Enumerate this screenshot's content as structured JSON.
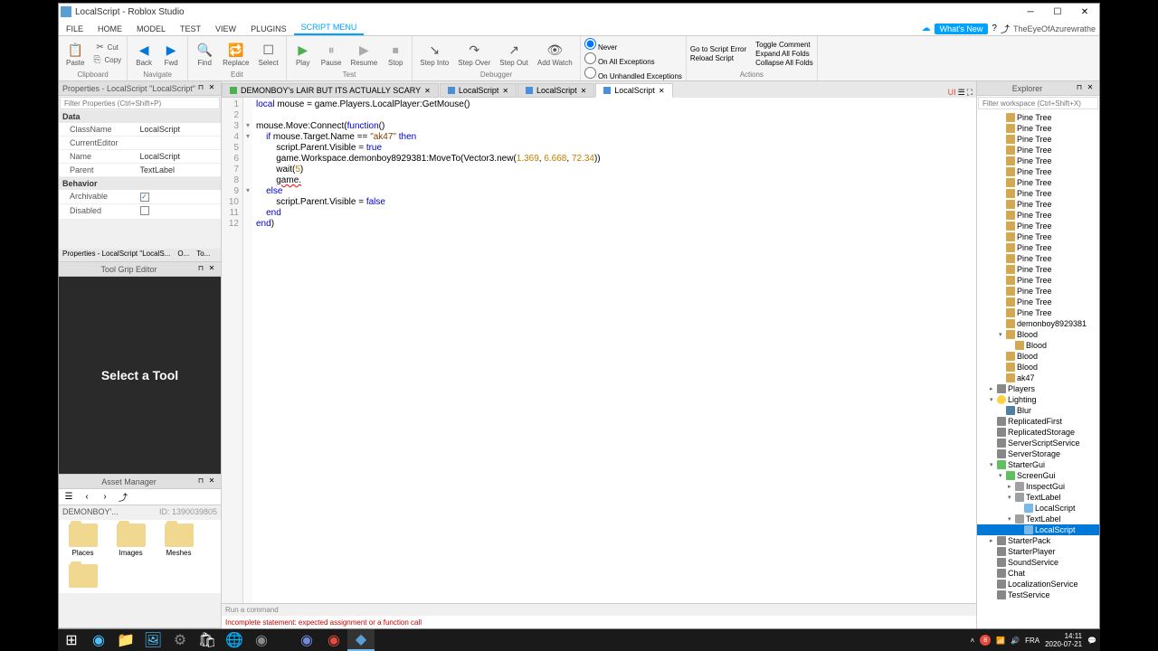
{
  "window": {
    "title": "LocalScript - Roblox Studio"
  },
  "menu": {
    "tabs": [
      "FILE",
      "HOME",
      "MODEL",
      "TEST",
      "VIEW",
      "PLUGINS",
      "SCRIPT MENU"
    ],
    "active": 6,
    "whats_new": "What's New",
    "username": "TheEyeOfAzurewrathe"
  },
  "ribbon": {
    "clipboard": {
      "label": "Clipboard",
      "paste": "Paste",
      "cut": "Cut",
      "copy": "Copy"
    },
    "navigate": {
      "label": "Navigate",
      "back": "Back",
      "fwd": "Fwd"
    },
    "edit": {
      "label": "Edit",
      "find": "Find",
      "replace": "Replace",
      "select": "Select"
    },
    "test": {
      "label": "Test",
      "play": "Play",
      "pause": "Pause",
      "resume": "Resume",
      "stop": "Stop"
    },
    "debugger": {
      "label": "Debugger",
      "step_into": "Step Into",
      "step_over": "Step Over",
      "step_out": "Step Out",
      "add_watch": "Add Watch"
    },
    "debug_errors": {
      "label": "Debug Errors",
      "never": "Never",
      "all_exceptions": "On All Exceptions",
      "unhandled": "On Unhandled Exceptions"
    },
    "actions": {
      "label": "Actions",
      "goto": "Go to Script Error",
      "reload": "Reload Script",
      "toggle_comment": "Toggle Comment",
      "expand": "Expand All Folds",
      "collapse": "Collapse All Folds"
    }
  },
  "properties": {
    "title": "Properties - LocalScript \"LocalScript\"",
    "filter_placeholder": "Filter Properties (Ctrl+Shift+P)",
    "sections": {
      "data": "Data",
      "behavior": "Behavior"
    },
    "rows": {
      "className": {
        "key": "ClassName",
        "val": "LocalScript"
      },
      "currentEditor": {
        "key": "CurrentEditor",
        "val": ""
      },
      "name": {
        "key": "Name",
        "val": "LocalScript"
      },
      "parent": {
        "key": "Parent",
        "val": "TextLabel"
      },
      "archivable": {
        "key": "Archivable",
        "checked": true
      },
      "disabled": {
        "key": "Disabled",
        "checked": false
      }
    },
    "tabs": [
      "Properties - LocalScript \"LocalS...",
      "O...",
      "To..."
    ]
  },
  "tool_grip": {
    "title": "Tool Grip Editor",
    "message": "Select a Tool"
  },
  "asset_manager": {
    "title": "Asset Manager",
    "breadcrumb": "DEMONBOY'...",
    "id_label": "ID: 1390039805",
    "folders": [
      "Places",
      "Images",
      "Meshes",
      ""
    ]
  },
  "editor_tabs": {
    "items": [
      {
        "label": "DEMONBOY's LAIR BUT ITS ACTUALLY SCARY",
        "icon": "place"
      },
      {
        "label": "LocalScript",
        "icon": "script"
      },
      {
        "label": "LocalScript",
        "icon": "script"
      },
      {
        "label": "LocalScript",
        "icon": "script",
        "active": true
      }
    ],
    "ui_toggle": "UI"
  },
  "code": {
    "lines": [
      {
        "n": 1,
        "text": "local mouse = game.Players.LocalPlayer:GetMouse()"
      },
      {
        "n": 2,
        "text": ""
      },
      {
        "n": 3,
        "text": "mouse.Move:Connect(function()"
      },
      {
        "n": 4,
        "text": "    if mouse.Target.Name == \"ak47\" then"
      },
      {
        "n": 5,
        "text": "        script.Parent.Visible = true"
      },
      {
        "n": 6,
        "text": "        game.Workspace.demonboy8929381:MoveTo(Vector3.new(1.369, 6.668, 72.34))"
      },
      {
        "n": 7,
        "text": "        wait(5)"
      },
      {
        "n": 8,
        "text": "        game."
      },
      {
        "n": 9,
        "text": "    else"
      },
      {
        "n": 10,
        "text": "        script.Parent.Visible = false"
      },
      {
        "n": 11,
        "text": "    end"
      },
      {
        "n": 12,
        "text": "end)"
      }
    ]
  },
  "command_bar": {
    "placeholder": "Run a command"
  },
  "status_bar": {
    "message": "Incomplete statement: expected assignment or a function call"
  },
  "explorer": {
    "title": "Explorer",
    "filter_placeholder": "Filter workspace (Ctrl+Shift+X)",
    "items": [
      {
        "depth": 2,
        "icon": "part",
        "label": "Pine Tree"
      },
      {
        "depth": 2,
        "icon": "part",
        "label": "Pine Tree"
      },
      {
        "depth": 2,
        "icon": "part",
        "label": "Pine Tree"
      },
      {
        "depth": 2,
        "icon": "part",
        "label": "Pine Tree"
      },
      {
        "depth": 2,
        "icon": "part",
        "label": "Pine Tree"
      },
      {
        "depth": 2,
        "icon": "part",
        "label": "Pine Tree"
      },
      {
        "depth": 2,
        "icon": "part",
        "label": "Pine Tree"
      },
      {
        "depth": 2,
        "icon": "part",
        "label": "Pine Tree"
      },
      {
        "depth": 2,
        "icon": "part",
        "label": "Pine Tree"
      },
      {
        "depth": 2,
        "icon": "part",
        "label": "Pine Tree"
      },
      {
        "depth": 2,
        "icon": "part",
        "label": "Pine Tree"
      },
      {
        "depth": 2,
        "icon": "part",
        "label": "Pine Tree"
      },
      {
        "depth": 2,
        "icon": "part",
        "label": "Pine Tree"
      },
      {
        "depth": 2,
        "icon": "part",
        "label": "Pine Tree"
      },
      {
        "depth": 2,
        "icon": "part",
        "label": "Pine Tree"
      },
      {
        "depth": 2,
        "icon": "part",
        "label": "Pine Tree"
      },
      {
        "depth": 2,
        "icon": "part",
        "label": "Pine Tree"
      },
      {
        "depth": 2,
        "icon": "part",
        "label": "Pine Tree"
      },
      {
        "depth": 2,
        "icon": "part",
        "label": "Pine Tree"
      },
      {
        "depth": 2,
        "icon": "part",
        "label": "demonboy8929381"
      },
      {
        "depth": 2,
        "icon": "part",
        "label": "Blood",
        "toggle": "▾"
      },
      {
        "depth": 3,
        "icon": "part",
        "label": "Blood"
      },
      {
        "depth": 2,
        "icon": "part",
        "label": "Blood"
      },
      {
        "depth": 2,
        "icon": "part",
        "label": "Blood"
      },
      {
        "depth": 2,
        "icon": "part",
        "label": "ak47"
      },
      {
        "depth": 1,
        "icon": "service",
        "label": "Players",
        "toggle": "▸"
      },
      {
        "depth": 1,
        "icon": "light",
        "label": "Lighting",
        "toggle": "▾"
      },
      {
        "depth": 2,
        "icon": "camera",
        "label": "Blur"
      },
      {
        "depth": 1,
        "icon": "service",
        "label": "ReplicatedFirst"
      },
      {
        "depth": 1,
        "icon": "service",
        "label": "ReplicatedStorage"
      },
      {
        "depth": 1,
        "icon": "service",
        "label": "ServerScriptService"
      },
      {
        "depth": 1,
        "icon": "service",
        "label": "ServerStorage"
      },
      {
        "depth": 1,
        "icon": "gui",
        "label": "StarterGui",
        "toggle": "▾"
      },
      {
        "depth": 2,
        "icon": "gui",
        "label": "ScreenGui",
        "toggle": "▾"
      },
      {
        "depth": 3,
        "icon": "text",
        "label": "InspectGui",
        "toggle": "▸"
      },
      {
        "depth": 3,
        "icon": "text",
        "label": "TextLabel",
        "toggle": "▾"
      },
      {
        "depth": 4,
        "icon": "localscript",
        "label": "LocalScript"
      },
      {
        "depth": 3,
        "icon": "text",
        "label": "TextLabel",
        "toggle": "▾"
      },
      {
        "depth": 4,
        "icon": "localscript",
        "label": "LocalScript",
        "selected": true
      },
      {
        "depth": 1,
        "icon": "service",
        "label": "StarterPack",
        "toggle": "▸"
      },
      {
        "depth": 1,
        "icon": "service",
        "label": "StarterPlayer"
      },
      {
        "depth": 1,
        "icon": "service",
        "label": "SoundService"
      },
      {
        "depth": 1,
        "icon": "service",
        "label": "Chat"
      },
      {
        "depth": 1,
        "icon": "service",
        "label": "LocalizationService"
      },
      {
        "depth": 1,
        "icon": "service",
        "label": "TestService"
      }
    ]
  },
  "taskbar": {
    "time": "14:11",
    "date": "2020-07-21",
    "lang": "FRA",
    "notif": "8"
  }
}
